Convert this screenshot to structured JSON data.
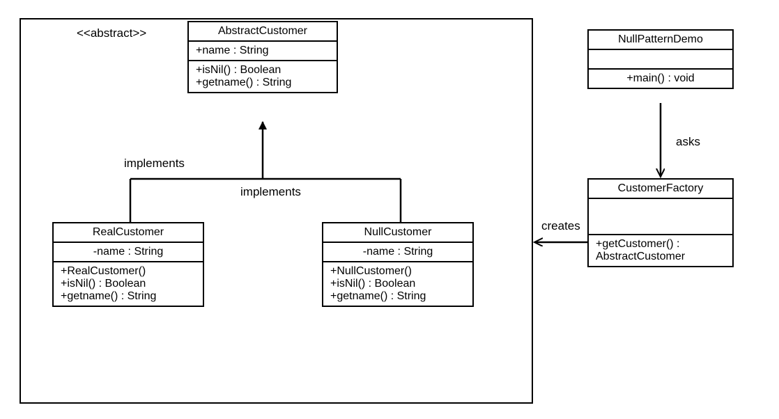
{
  "stereotype": "<<abstract>>",
  "classes": {
    "abstractCustomer": {
      "name": "AbstractCustomer",
      "attr1": "+name : String",
      "op1": "+isNil() : Boolean",
      "op2": "+getname() : String"
    },
    "realCustomer": {
      "name": "RealCustomer",
      "attr1": "-name : String",
      "op1": "+RealCustomer()",
      "op2": "+isNil() : Boolean",
      "op3": "+getname() : String"
    },
    "nullCustomer": {
      "name": "NullCustomer",
      "attr1": "-name : String",
      "op1": "+NullCustomer()",
      "op2": "+isNil() : Boolean",
      "op3": "+getname() : String"
    },
    "nullPatternDemo": {
      "name": "NullPatternDemo",
      "op1": "+main() : void"
    },
    "customerFactory": {
      "name": "CustomerFactory",
      "op1": "+getCustomer() :",
      "op2": "AbstractCustomer"
    }
  },
  "labels": {
    "implements1": "implements",
    "implements2": "implements",
    "asks": "asks",
    "creates": "creates"
  }
}
